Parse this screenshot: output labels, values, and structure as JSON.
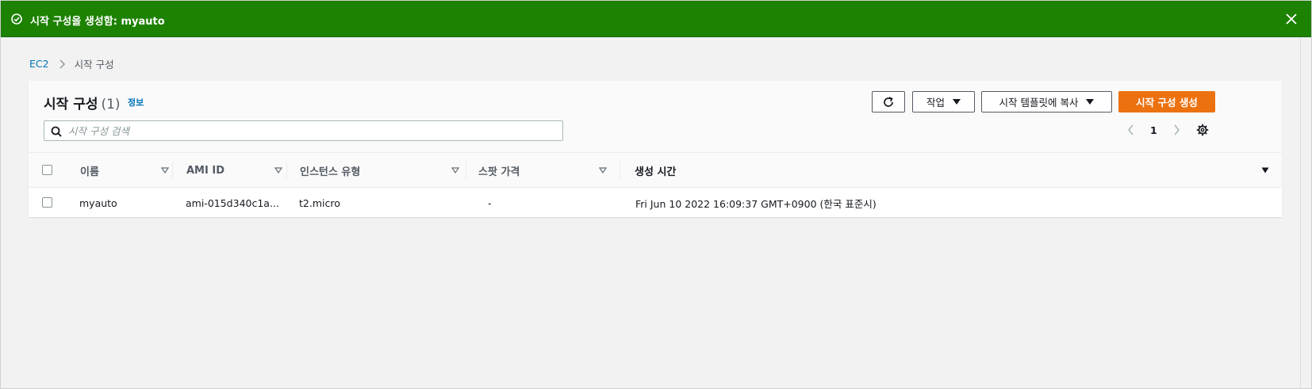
{
  "flash": {
    "message": "시작 구성을 생성함: myauto",
    "status_icon": "check-circle-icon",
    "close_icon": "close-icon",
    "color": "#1d8102"
  },
  "breadcrumb": {
    "root": "EC2",
    "current": "시작 구성"
  },
  "panel": {
    "title": "시작 구성",
    "count": "(1)",
    "info_link": "정보"
  },
  "toolbar": {
    "refresh_icon": "refresh-icon",
    "actions_label": "작업",
    "copy_template_label": "시작 템플릿에 복사",
    "create_label": "시작 구성 생성",
    "primary_color": "#ec7211"
  },
  "search": {
    "placeholder": "시작 구성 검색",
    "value": ""
  },
  "pagination": {
    "current_page": "1"
  },
  "table": {
    "columns": [
      "이름",
      "AMI ID",
      "인스턴스 유형",
      "스팟 가격",
      "생성 시간"
    ],
    "rows": [
      {
        "name": "myauto",
        "ami_id": "ami-015d340c1a...",
        "instance_type": "t2.micro",
        "spot_price": "-",
        "created": "Fri Jun 10 2022 16:09:37 GMT+0900 (한국 표준시)"
      }
    ]
  }
}
